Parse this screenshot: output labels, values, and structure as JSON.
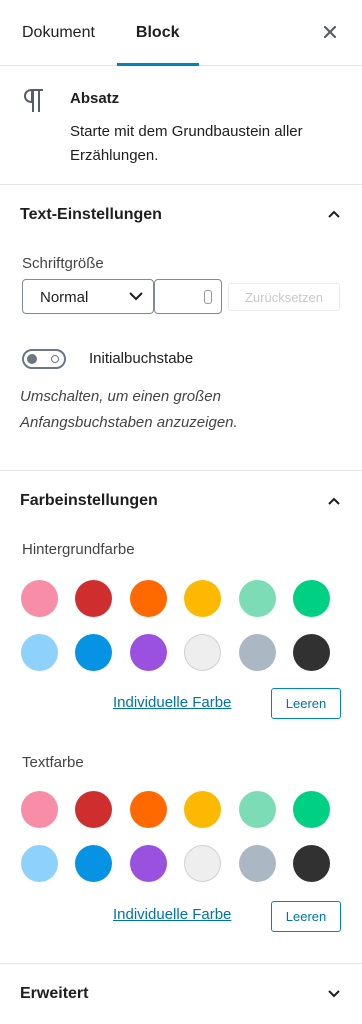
{
  "tabs": {
    "document": "Dokument",
    "block": "Block"
  },
  "block": {
    "icon": "paragraph-icon",
    "name": "Absatz",
    "description": "Starte mit dem Grundbaustein aller Erzählungen."
  },
  "text_settings": {
    "title": "Text-Einstellungen",
    "font_size_label": "Schriftgröße",
    "font_size_value": "Normal",
    "custom_size_value": "",
    "reset_label": "Zurücksetzen",
    "dropcap_label": "Initialbuchstabe",
    "dropcap_enabled": false,
    "dropcap_help": "Umschalten, um einen großen Anfangsbuchstaben anzuzeigen."
  },
  "color_settings": {
    "title": "Farbeinstellungen",
    "background_label": "Hintergrundfarbe",
    "text_label": "Textfarbe",
    "custom_color_label": "Individuelle Farbe",
    "clear_label": "Leeren",
    "palette": [
      "#f78da7",
      "#cf2e2e",
      "#ff6900",
      "#fcb900",
      "#7bdcb5",
      "#00d084",
      "#8ed1fc",
      "#0693e3",
      "#9b51e0",
      "#eeeeee",
      "#abb8c3",
      "#313131"
    ]
  },
  "advanced": {
    "title": "Erweitert"
  }
}
